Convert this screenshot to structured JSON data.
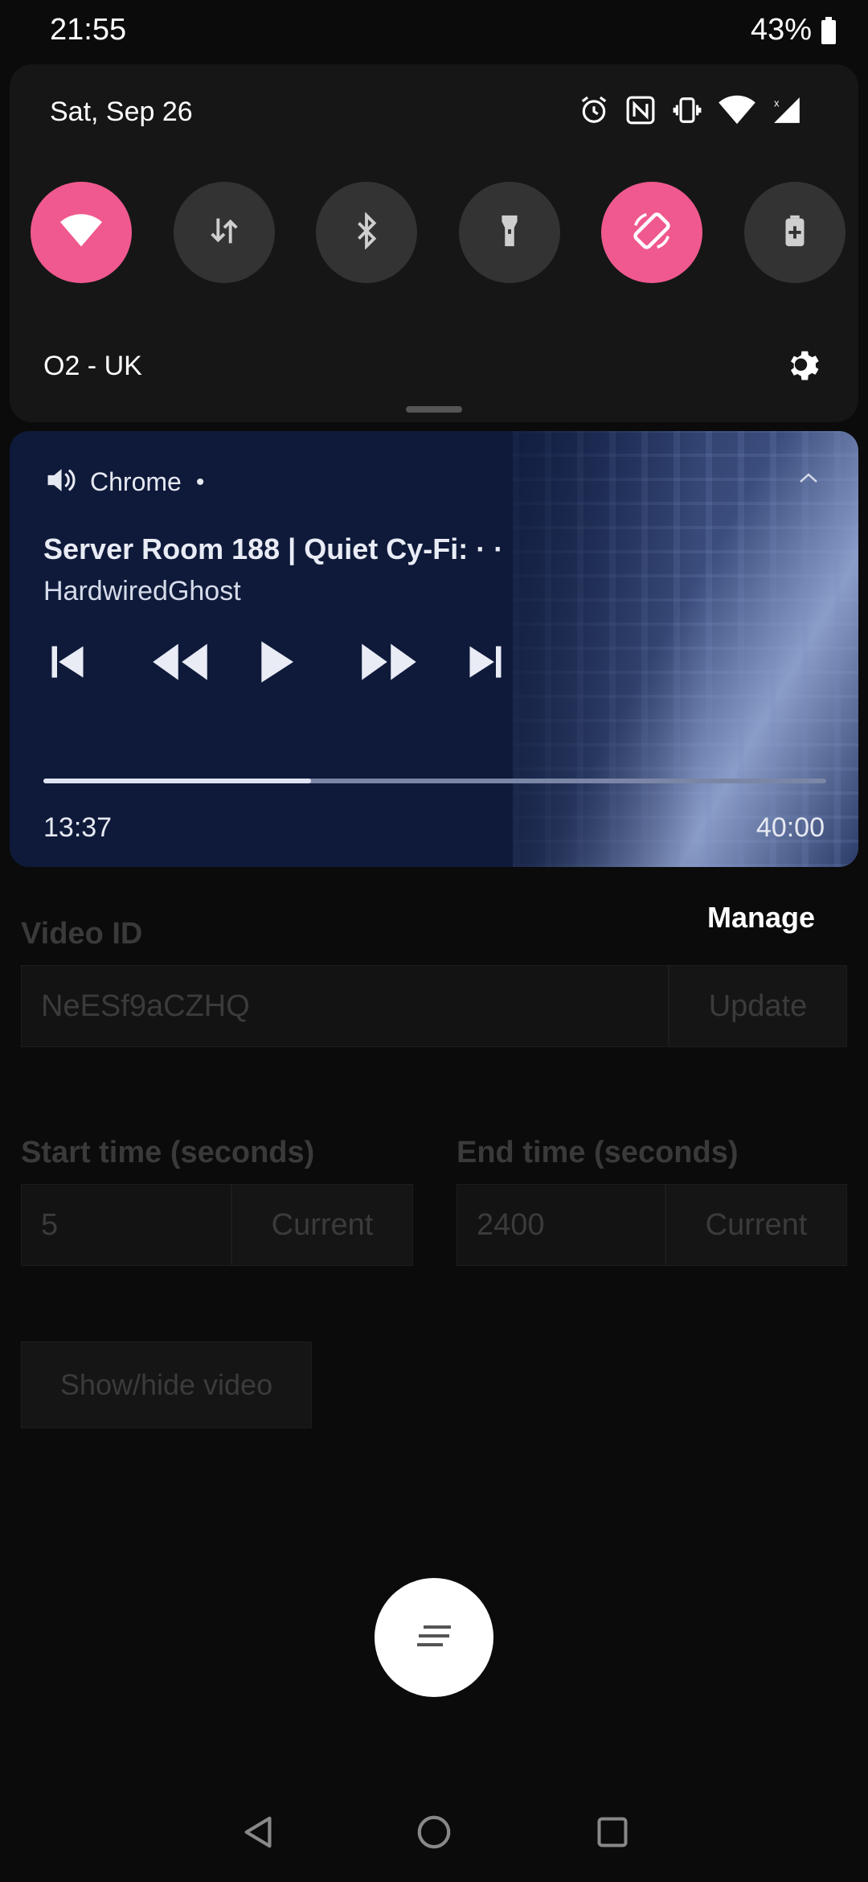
{
  "status_bar": {
    "time": "21:55",
    "battery": "43%"
  },
  "quick_settings": {
    "date": "Sat, Sep 26",
    "carrier": "O2 - UK",
    "tiles": [
      {
        "name": "wifi",
        "active": true
      },
      {
        "name": "mobile-data",
        "active": false
      },
      {
        "name": "bluetooth",
        "active": false
      },
      {
        "name": "flashlight",
        "active": false
      },
      {
        "name": "auto-rotate",
        "active": true
      },
      {
        "name": "battery-saver",
        "active": false
      }
    ],
    "accent_color": "#f0598f"
  },
  "media": {
    "app": "Chrome",
    "title": "Server Room 188 | Quiet Cy-Fi: · ·",
    "artist": "HardwiredGhost",
    "elapsed": "13:37",
    "duration": "40:00",
    "progress_fraction": 0.342
  },
  "page": {
    "manage_label": "Manage",
    "video_id_label": "Video ID",
    "video_id_value": "NeESf9aCZHQ",
    "update_label": "Update",
    "start_label": "Start time (seconds)",
    "start_value": "5",
    "end_label": "End time (seconds)",
    "end_value": "2400",
    "current_label": "Current",
    "show_hide_label": "Show/hide video"
  }
}
